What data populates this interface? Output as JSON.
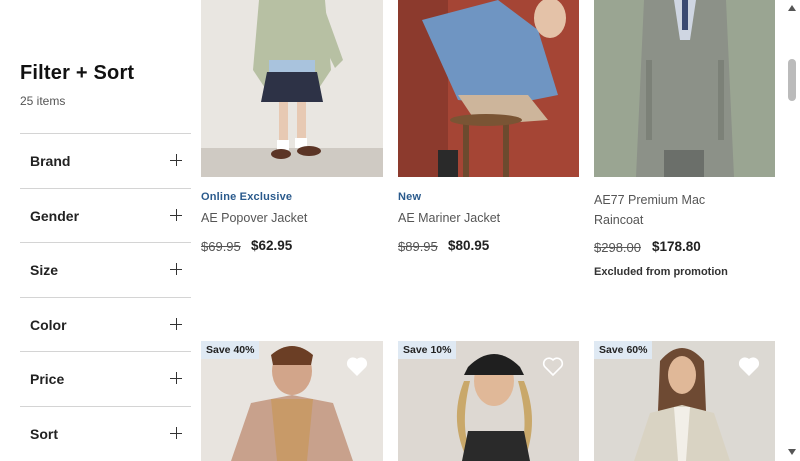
{
  "sidebar": {
    "title": "Filter + Sort",
    "count": "25 items",
    "facets": [
      {
        "label": "Brand"
      },
      {
        "label": "Gender"
      },
      {
        "label": "Size"
      },
      {
        "label": "Color"
      },
      {
        "label": "Price"
      },
      {
        "label": "Sort"
      }
    ]
  },
  "products": [
    {
      "tag": "Online Exclusive",
      "name": "AE Popover Jacket",
      "old_price": "$69.95",
      "price": "$62.95"
    },
    {
      "tag": "New",
      "name": "AE Mariner Jacket",
      "old_price": "$89.95",
      "price": "$80.95"
    },
    {
      "tag": "",
      "name_line1": "AE77 Premium Mac",
      "name_line2": "Raincoat",
      "old_price": "$298.00",
      "price": "$178.80",
      "note": "Excluded from promotion"
    }
  ],
  "row2": [
    {
      "badge": "Save 40%"
    },
    {
      "badge": "Save 10%"
    },
    {
      "badge": "Save 60%"
    }
  ],
  "colors": {
    "tag": "#2a5a8c",
    "badge_bg": "#dfe9f3"
  }
}
